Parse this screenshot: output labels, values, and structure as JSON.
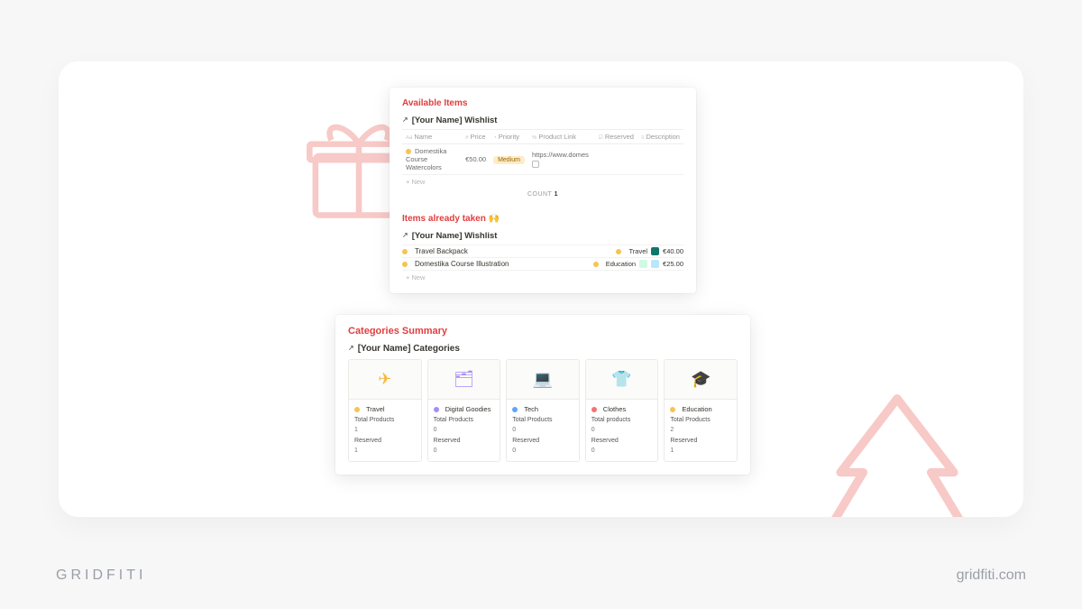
{
  "footer": {
    "brand": "GRIDFITI",
    "site": "gridfiti.com"
  },
  "panelA": {
    "section1": {
      "title": "Available Items",
      "subtitle": "[Your Name] Wishlist",
      "columns": {
        "name": "Name",
        "price": "Price",
        "priority": "Priority",
        "link": "Product Link",
        "reserved": "Reserved",
        "description": "Description"
      },
      "row": {
        "name": "Domestika Course Watercolors",
        "price": "€50.00",
        "priority": "Medium",
        "link": "https://www.domes"
      },
      "new": "+  New",
      "count_label": "COUNT",
      "count_value": "1"
    },
    "section2": {
      "title": "Items already taken 🙌",
      "subtitle": "[Your Name] Wishlist",
      "rows": [
        {
          "name": "Travel Backpack",
          "cat": "Travel",
          "price": "€40.00"
        },
        {
          "name": "Domestika Course Illustration",
          "cat": "Education",
          "price": "€25.00"
        }
      ],
      "new": "+  New"
    }
  },
  "panelB": {
    "title": "Categories Summary",
    "subtitle": "[Your Name] Categories",
    "labels": {
      "total": "Total Products",
      "reserved": "Reserved",
      "total_alt": "Total products"
    },
    "cards": [
      {
        "icon": "✈",
        "dot": "yellow",
        "iconClass": "ic-travel",
        "name": "Travel",
        "total": "1",
        "reserved": "1",
        "alt": false
      },
      {
        "icon": "🗂",
        "dot": "purple",
        "iconClass": "ic-digital",
        "name": "Digital Goodies",
        "total": "0",
        "reserved": "0",
        "alt": false
      },
      {
        "icon": "💻",
        "dot": "blue",
        "iconClass": "ic-tech",
        "name": "Tech",
        "total": "0",
        "reserved": "0",
        "alt": false
      },
      {
        "icon": "👕",
        "dot": "red",
        "iconClass": "ic-clothes",
        "name": "Clothes",
        "total": "0",
        "reserved": "0",
        "alt": true
      },
      {
        "icon": "🎓",
        "dot": "yellow",
        "iconClass": "ic-edu",
        "name": "Education",
        "total": "2",
        "reserved": "1",
        "alt": false
      }
    ]
  }
}
